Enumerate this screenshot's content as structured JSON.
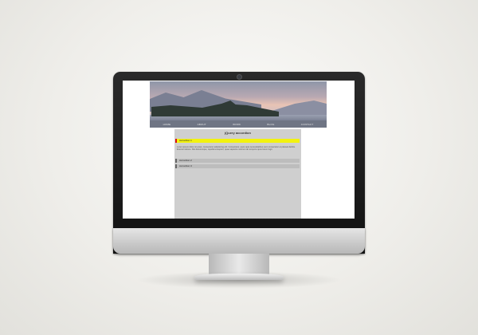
{
  "site": {
    "nav_items": [
      "HOME",
      "ABOUT",
      "WORK",
      "BLOG",
      "CONTACT"
    ],
    "panel_title": "jQuery accordion",
    "accordion": [
      {
        "label": "Accordion 1",
        "active": true,
        "body": "Lorem ipsum dolor sit amet, consectetur adipisicing elit. Consectetur, quos quia necessitatibus sunt consectetur et placeat debitis. Eveniet ratione. Nisi doloremque, repellat excepturi, quae sapiente nostrum ab tempore quos lorem fugit."
      },
      {
        "label": "Accordion 2",
        "active": false
      },
      {
        "label": "Accordion 3",
        "active": false
      }
    ]
  },
  "colors": {
    "active_header": "#f2f20f",
    "active_marker": "#dd1111",
    "panel_bg": "#cfcfcf"
  }
}
